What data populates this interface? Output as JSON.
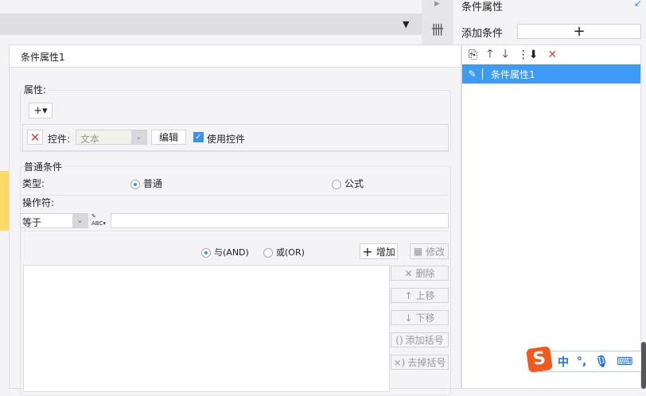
{
  "right_panel": {
    "title": "条件属性",
    "add_condition_label": "添加条件",
    "add_button": "+",
    "list_items": [
      {
        "label": "条件属性1",
        "selected": true
      }
    ]
  },
  "dialog": {
    "title": "条件属性1",
    "properties": {
      "legend": "属性:",
      "add_button": "+▾",
      "control_label": "控件:",
      "control_value": "文本",
      "edit_button": "编辑",
      "use_control_label": "使用控件",
      "use_control_checked": true
    },
    "normal_condition": {
      "legend": "普通条件",
      "type_label": "类型:",
      "type_options": [
        "普通",
        "公式"
      ],
      "type_selected": "普通",
      "operator_label": "操作符:",
      "operator_value": "等于",
      "value_input": "",
      "logic_options": [
        "与(AND)",
        "或(OR)"
      ],
      "logic_selected": "与(AND)",
      "add_button": "增加",
      "modify_button": "修改",
      "delete_button": "删除",
      "move_up_button": "上移",
      "move_down_button": "下移",
      "add_bracket_button": "添加括号",
      "remove_bracket_button": "去掉括号"
    }
  },
  "ime": {
    "mode": "中",
    "punct": "°,"
  },
  "colors": {
    "accent": "#3d9af5",
    "danger": "#e8413c"
  }
}
